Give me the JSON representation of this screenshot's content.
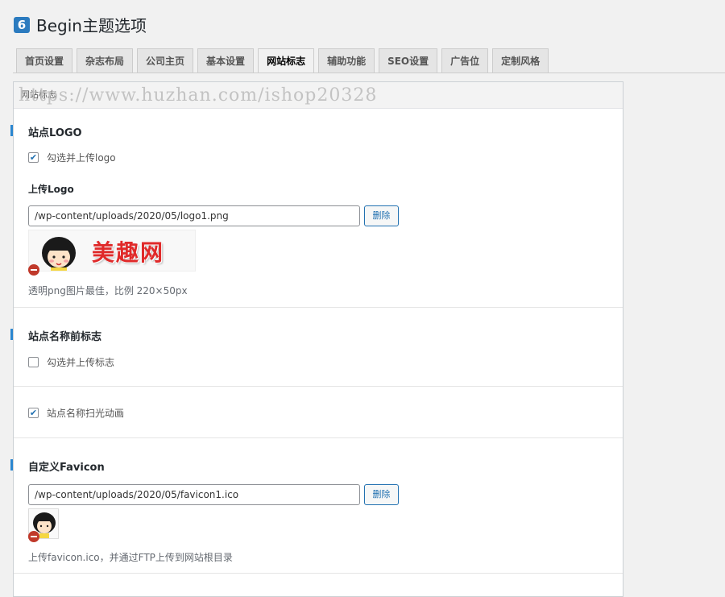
{
  "header": {
    "title": "Begin主题选项",
    "logo_icon": "begin-logo-icon"
  },
  "tabs": [
    {
      "label": "首页设置",
      "active": false
    },
    {
      "label": "杂志布局",
      "active": false
    },
    {
      "label": "公司主页",
      "active": false
    },
    {
      "label": "基本设置",
      "active": false
    },
    {
      "label": "网站标志",
      "active": true
    },
    {
      "label": "辅助功能",
      "active": false
    },
    {
      "label": "SEO设置",
      "active": false
    },
    {
      "label": "广告位",
      "active": false
    },
    {
      "label": "定制风格",
      "active": false
    }
  ],
  "panel": {
    "head_label": "网站标志",
    "watermark": "https://www.huzhan.com/ishop20328"
  },
  "logo_section": {
    "title": "站点LOGO",
    "enable_label": "勾选并上传logo",
    "enable_checked": true,
    "upload_title": "上传Logo",
    "upload_value": "/wp-content/uploads/2020/05/logo1.png",
    "delete_label": "删除",
    "preview_text": "美趣网",
    "help": "透明png图片最佳，比例 220×50px"
  },
  "prefix_section": {
    "title": "站点名称前标志",
    "enable_label": "勾选并上传标志",
    "enable_checked": false
  },
  "animation_section": {
    "enable_label": "站点名称扫光动画",
    "enable_checked": true
  },
  "favicon_section": {
    "title": "自定义Favicon",
    "upload_value": "/wp-content/uploads/2020/05/favicon1.ico",
    "delete_label": "删除",
    "help": "上传favicon.ico，并通过FTP上传到网站根目录"
  },
  "colors": {
    "accent": "#2b86d0",
    "remove": "#c0392b",
    "button": "#2271b1"
  }
}
